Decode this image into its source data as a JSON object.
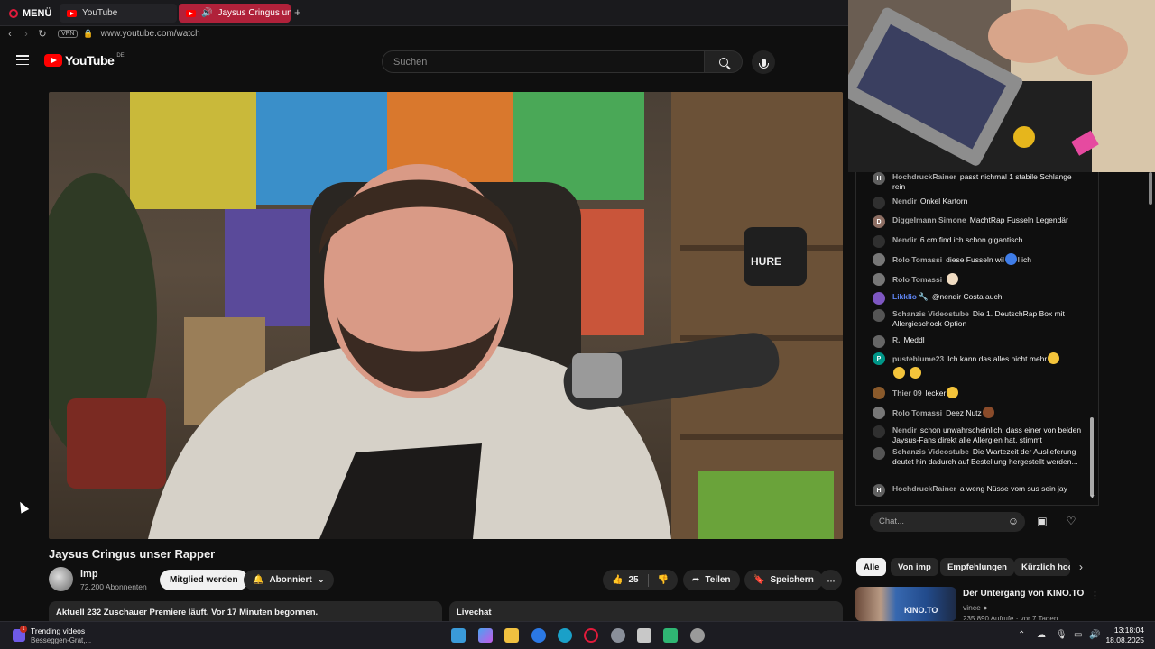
{
  "browser": {
    "menu_label": "MENÜ",
    "tabs": [
      {
        "label": "YouTube"
      },
      {
        "label": "Jaysus Cringus unser"
      }
    ],
    "vpn_label": "VPN",
    "url": "www.youtube.com/watch"
  },
  "yt": {
    "logo_text": "YouTube",
    "country_code": "DE",
    "search_placeholder": "Suchen"
  },
  "video": {
    "title": "Jaysus Cringus unser Rapper",
    "channel": "imp",
    "subscribers": "72.200 Abonnenten",
    "join_label": "Mitglied werden",
    "subscribed_label": "Abonniert",
    "likes": "25",
    "share_label": "Teilen",
    "save_label": "Speichern",
    "more": "···",
    "viewers_line": "Aktuell 232 Zuschauer  Premiere läuft. Vor 17 Minuten begonnen.",
    "livechat_label": "Livechat",
    "mic_brand": "HURE"
  },
  "chat": {
    "input_placeholder": "Chat...",
    "messages": [
      {
        "avatar": "H",
        "author": "HochdruckRainer",
        "text": "passt nichmal 1 stabile Schlange rein",
        "color": "#606060"
      },
      {
        "avatar": "",
        "author": "Nendir",
        "text": "Onkel Kartorn",
        "color": "#303030"
      },
      {
        "avatar": "D",
        "author": "Diggelmann Simone",
        "text": "MachtRap Fusseln Legendär",
        "color": "#8d6e63"
      },
      {
        "avatar": "",
        "author": "Nendir",
        "text": "6 cm find ich schon gigantisch",
        "color": "#303030"
      },
      {
        "avatar": "",
        "author": "Rolo Tomassi",
        "text": "diese Fusseln wil",
        "text2": "l ich",
        "emoji": "blue",
        "color": "#777777"
      },
      {
        "avatar": "",
        "author": "Rolo Tomassi",
        "text": "",
        "emoji": "cream",
        "color": "#777777"
      },
      {
        "avatar": "",
        "author": "Likklio 🔧",
        "text": "@nendir Costa auch",
        "color": "#7e57c2",
        "mod": true
      },
      {
        "avatar": "",
        "author": "Schanzis Videostube",
        "text": "Die 1. DeutschRap Box mit Allergieschock Option",
        "color": "#555555"
      },
      {
        "avatar": "",
        "author": "R.",
        "text": "Meddl",
        "color": "#666666"
      },
      {
        "avatar": "P",
        "author": "pusteblume23",
        "text": "Ich kann das alles nicht mehr",
        "emoji": "yellow",
        "extra_emojis": "yellow",
        "color": "#009688"
      },
      {
        "avatar": "",
        "author": "Thier 09",
        "text": "lecker",
        "emoji": "yellow",
        "color": "#8a5a2b"
      },
      {
        "avatar": "",
        "author": "Rolo Tomassi",
        "text": "Deez Nutz",
        "emoji": "brown",
        "color": "#777777"
      },
      {
        "avatar": "",
        "author": "Nendir",
        "text": "schon unwahrscheinlich, dass einer von beiden Jaysus-Fans direkt alle Allergien hat, stimmt",
        "color": "#303030"
      },
      {
        "avatar": "",
        "author": "Schanzis Videostube",
        "text": "Die Wartezeit der Auslieferung deutet hin dadurch auf Bestellung hergestellt werden...",
        "color": "#555555"
      },
      {
        "avatar": "H",
        "author": "HochdruckRainer",
        "text": "a weng Nüsse vom sus sein jay",
        "color": "#606060"
      }
    ]
  },
  "chips": [
    "Alle",
    "Von imp",
    "Empfehlungen",
    "Kürzlich hochgeladen"
  ],
  "recommendation": {
    "title": "Der Untergang von KINO.TO",
    "channel": "vince",
    "meta": "235.890 Aufrufe · vor 7 Tagen",
    "thumb_text": "KINO.TO"
  },
  "taskbar": {
    "news_title": "Trending videos",
    "news_sub": "Besseggen-Grat,...",
    "news_badge": "1",
    "time": "13:18:04",
    "date": "18.08.2025"
  }
}
